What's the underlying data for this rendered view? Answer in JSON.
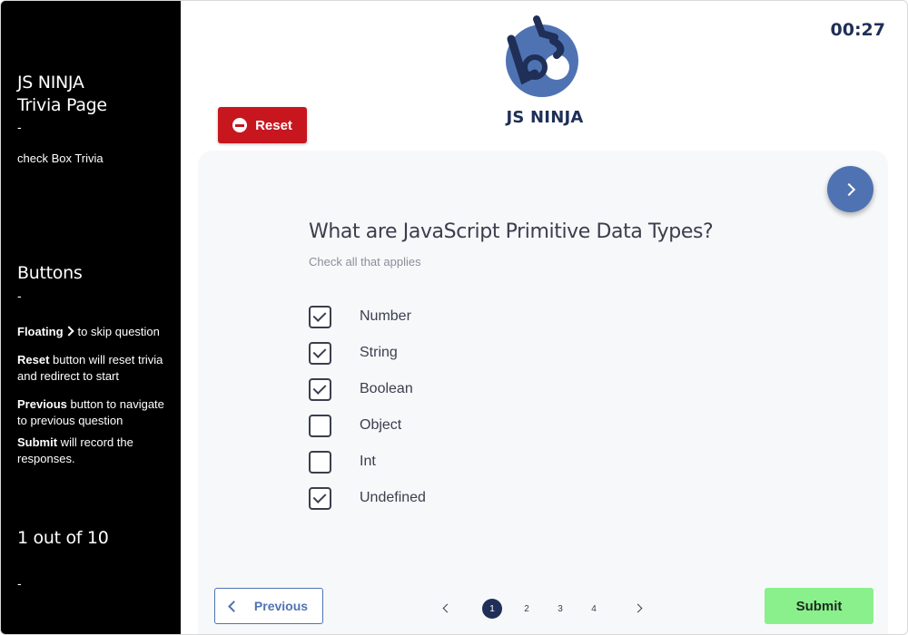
{
  "sidebar": {
    "title_line1": "JS NINJA",
    "title_line2": "Trivia Page",
    "dash": "-",
    "subtitle": "check Box Trivia",
    "buttons_heading": "Buttons",
    "notes": [
      {
        "bold": "Floating",
        "rest": "to skip question"
      },
      {
        "bold": "Reset",
        "rest": " button will reset trivia and redirect to start"
      },
      {
        "bold": "Previous",
        "rest": " button to navigate to previous question"
      },
      {
        "bold": "Submit",
        "rest": " will record the responses."
      }
    ],
    "progress": "1 out of 10"
  },
  "timer": "00:27",
  "logo": {
    "text": "JS NINJA",
    "color": "#4f73b2",
    "mark_color": "#1f2f57"
  },
  "reset_label": "Reset",
  "question": {
    "text": "What are JavaScript Primitive Data Types?",
    "hint": "Check all that applies",
    "options": [
      {
        "label": "Number",
        "checked": true
      },
      {
        "label": "String",
        "checked": true
      },
      {
        "label": "Boolean",
        "checked": true
      },
      {
        "label": "Object",
        "checked": false
      },
      {
        "label": "Int",
        "checked": false
      },
      {
        "label": "Undefined",
        "checked": true
      }
    ]
  },
  "nav": {
    "previous_label": "Previous",
    "submit_label": "Submit",
    "pages": [
      "1",
      "2",
      "3",
      "4"
    ],
    "current_page": "1"
  },
  "colors": {
    "sidebar_bg": "#000000",
    "accent": "#4f73b2",
    "reset": "#c8161f",
    "submit": "#8af08b",
    "navy": "#1f2f57"
  }
}
